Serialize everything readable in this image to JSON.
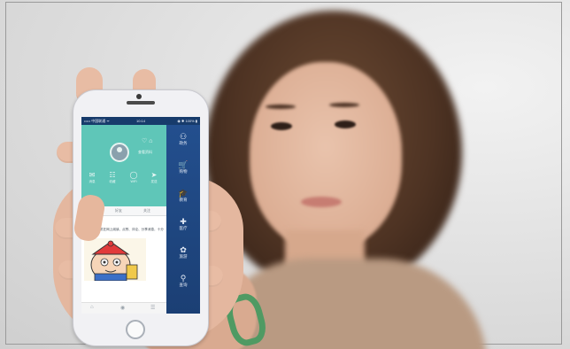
{
  "phone": {
    "status": {
      "carrier": "••••• 中国联通 ᯤ",
      "time": "10:14",
      "battery": "◉ ✱ 100% ▮"
    },
    "profile": {
      "head_icons": "♡ ⌂",
      "head_label": "查看资料"
    },
    "shortcuts": [
      {
        "icon": "✉",
        "label": "消息"
      },
      {
        "icon": "☷",
        "label": "收藏"
      },
      {
        "icon": "◯",
        "label": "WiFi"
      },
      {
        "icon": "➤",
        "label": "发送"
      }
    ],
    "tabs": [
      "全部",
      "好友",
      "关注"
    ],
    "post": {
      "user": "喜小坊",
      "text": "网民通过手机在网上阅读、点赞、评论、分享消息，十分有趣"
    },
    "bottom_icons": [
      "⌂",
      "◉",
      "☰"
    ],
    "drawer": [
      {
        "icon": "⚇",
        "label": "政务"
      },
      {
        "icon": "🛒",
        "label": "购物"
      },
      {
        "icon": "🎓",
        "label": "教育"
      },
      {
        "icon": "✚",
        "label": "医疗"
      },
      {
        "icon": "✿",
        "label": "旅游"
      },
      {
        "icon": "⚲",
        "label": "查询"
      }
    ]
  },
  "colors": {
    "profile_header": "#5fc6b8",
    "drawer": "#234f8e",
    "bracelet": "#4f9a63"
  }
}
